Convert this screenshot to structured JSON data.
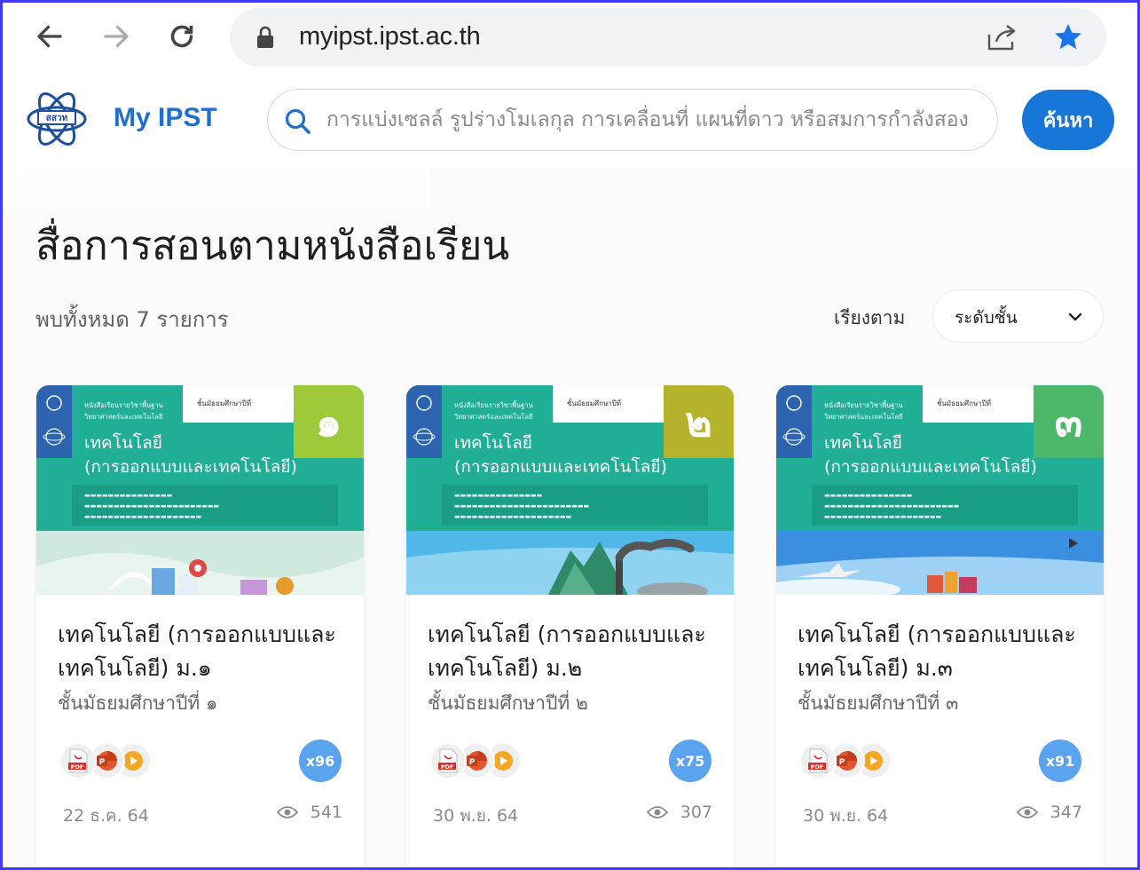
{
  "browser": {
    "url": "myipst.ipst.ac.th"
  },
  "header": {
    "brand": "My IPST",
    "search_placeholder": "การแบ่งเซลล์ รูปร่างโมเลกุล การเคลื่อนที่ แผนที่ดาว หรือสมการกำลังสอง",
    "search_button": "ค้นหา"
  },
  "main": {
    "title": "สื่อการสอนตามหนังสือเรียน",
    "result_count": "พบทั้งหมด 7 รายการ",
    "sort_label": "เรียงตาม",
    "sort_value": "ระดับชั้น"
  },
  "cards": [
    {
      "cover_numeral": "๑",
      "cover_color": "#9ec93a",
      "cover_small": "หนังสือเรียนรายวิชาพื้นฐาน\nวิทยาศาสตร์และเทคโนโลยี",
      "cover_grade": "ชั้นมัธยมศึกษาปีที่",
      "cover_title": "เทคโนโลยี\n(การออกแบบและเทคโนโลยี)",
      "title": "เทคโนโลยี (การออกแบบและเทคโนโลยี) ม.๑",
      "subtitle": "ชั้นมัธยมศึกษาปีที่ ๑",
      "count": "x96",
      "date": "22 ธ.ค. 64",
      "views": "541"
    },
    {
      "cover_numeral": "๒",
      "cover_color": "#b5b32c",
      "cover_small": "หนังสือเรียนรายวิชาพื้นฐาน\nวิทยาศาสตร์และเทคโนโลยี",
      "cover_grade": "ชั้นมัธยมศึกษาปีที่",
      "cover_title": "เทคโนโลยี\n(การออกแบบและเทคโนโลยี)",
      "title": "เทคโนโลยี (การออกแบบและเทคโนโลยี) ม.๒",
      "subtitle": "ชั้นมัธยมศึกษาปีที่ ๒",
      "count": "x75",
      "date": "30 พ.ย. 64",
      "views": "307"
    },
    {
      "cover_numeral": "๓",
      "cover_color": "#4db86a",
      "cover_small": "หนังสือเรียนรายวิชาพื้นฐาน\nวิทยาศาสตร์และเทคโนโลยี",
      "cover_grade": "ชั้นมัธยมศึกษาปีที่",
      "cover_title": "เทคโนโลยี\n(การออกแบบและเทคโนโลยี)",
      "title": "เทคโนโลยี (การออกแบบและเทคโนโลยี) ม.๓",
      "subtitle": "ชั้นมัธยมศึกษาปีที่ ๓",
      "count": "x91",
      "date": "30 พ.ย. 64",
      "views": "347"
    }
  ],
  "icons": {
    "back": "arrow-left-icon",
    "forward": "arrow-right-icon",
    "reload": "reload-icon",
    "lock": "lock-icon",
    "share": "share-icon",
    "bookmark": "star-icon",
    "search": "search-icon",
    "chevron": "chevron-down-icon",
    "pdf": "pdf-icon",
    "powerpoint": "powerpoint-icon",
    "video": "play-icon",
    "views": "eye-icon"
  },
  "colors": {
    "accent": "#1677d8",
    "brand": "#1e6fd0",
    "badge": "#5aa3ef",
    "cover_green": "#20ae96"
  }
}
